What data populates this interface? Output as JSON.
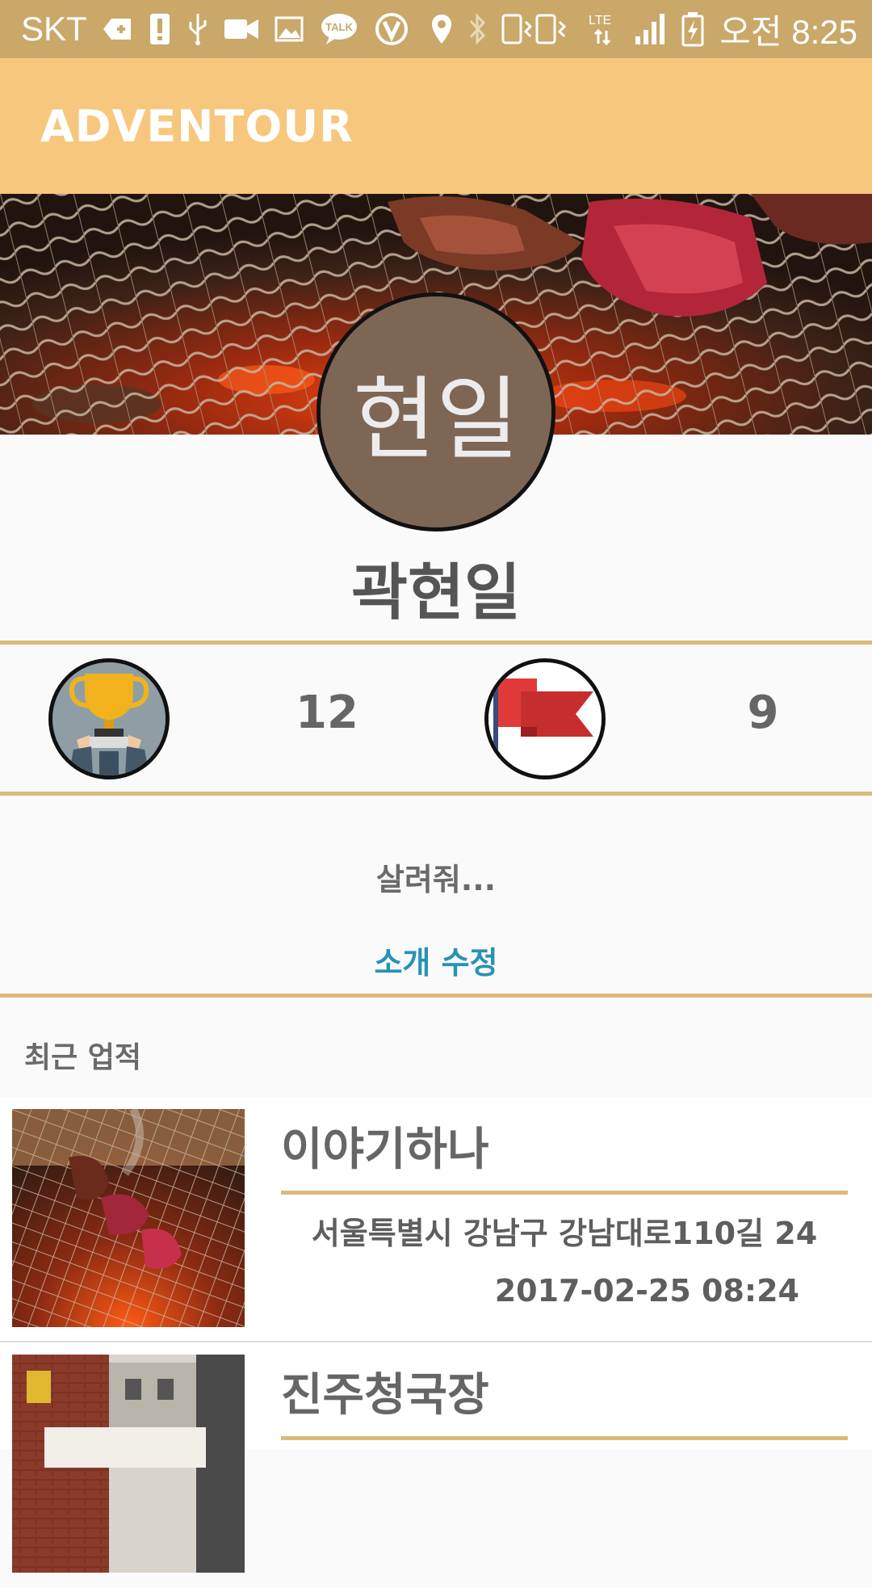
{
  "status_bar": {
    "carrier": "SKT",
    "talk_badge": "TALK",
    "lte_label": "LTE",
    "time": "오전 8:25",
    "icons": [
      "plus-tag-icon",
      "alert-icon",
      "usb-icon",
      "video-icon",
      "image-icon",
      "kakaotalk-icon",
      "v3-icon",
      "location-icon",
      "bluetooth-icon",
      "vibrate-icon",
      "lte-icon",
      "signal-icon",
      "battery-charging-icon"
    ]
  },
  "app_bar": {
    "title": "ADVENTOUR"
  },
  "profile": {
    "avatar_text": "현일",
    "name": "곽현일",
    "trophy_count": "12",
    "flag_count": "9",
    "intro": "살려줘...",
    "edit_intro_label": "소개 수정"
  },
  "recent": {
    "title": "최근 업적",
    "items": [
      {
        "name": "이야기하나",
        "address": "서울특별시 강남구 강남대로110길 24",
        "date": "2017-02-25 08:24"
      },
      {
        "name": "진주청국장"
      }
    ]
  },
  "colors": {
    "status_bar": "#c9a86a",
    "app_bar": "#f6c77d",
    "accent_line": "#ddb879",
    "link": "#2792b6",
    "avatar_bg": "#7e6655"
  }
}
